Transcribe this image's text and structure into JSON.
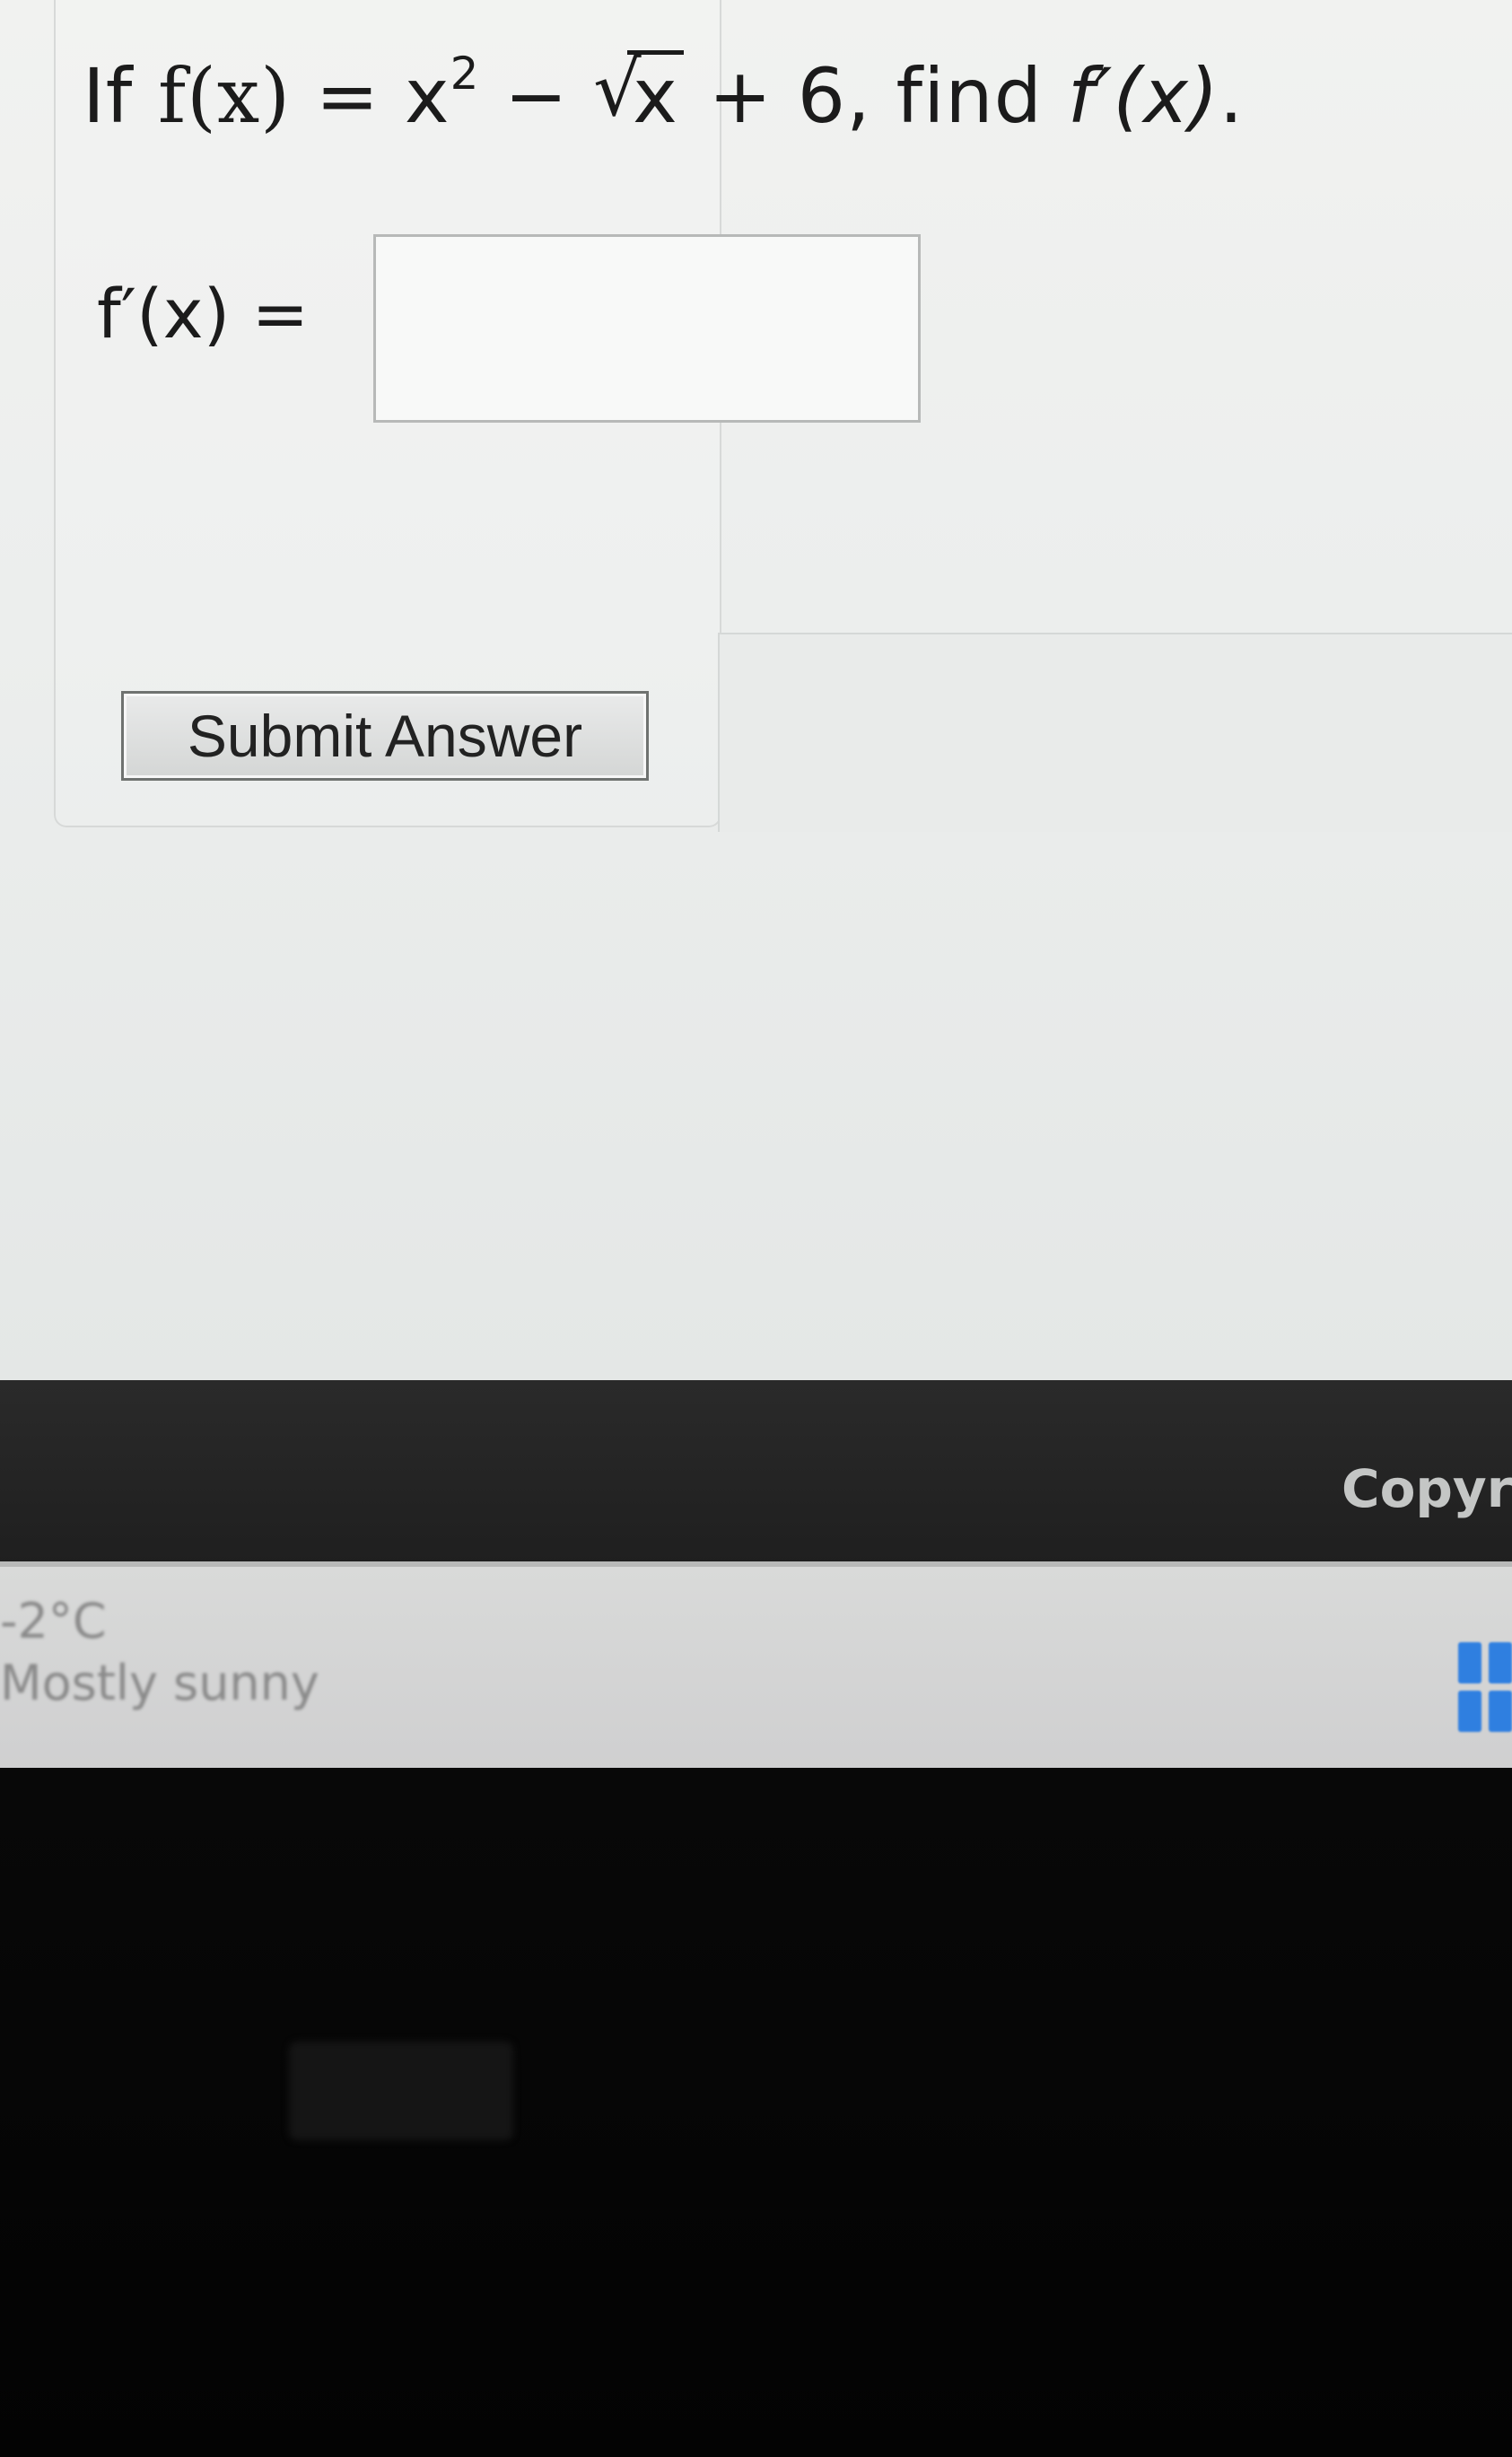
{
  "question": {
    "prefix": "If ",
    "func": "f(x)",
    "equals": " = x",
    "exp": "2",
    "minus": " − ",
    "radical_sign": "√",
    "radicand": "x",
    "rest": " + 6, find ",
    "target": "f′(x)",
    "end": "."
  },
  "answer": {
    "label": "f′(x) =",
    "value": ""
  },
  "submit": {
    "label": "Submit Answer"
  },
  "footer": {
    "copyright_text": "Copyri"
  },
  "taskbar": {
    "temperature": "-2°C",
    "condition": "Mostly sunny",
    "start_icon": "windows-start-icon"
  },
  "colors": {
    "start_icon": "#2f7fe0",
    "page_bg": "#eceeed",
    "footer_band": "#242424"
  }
}
